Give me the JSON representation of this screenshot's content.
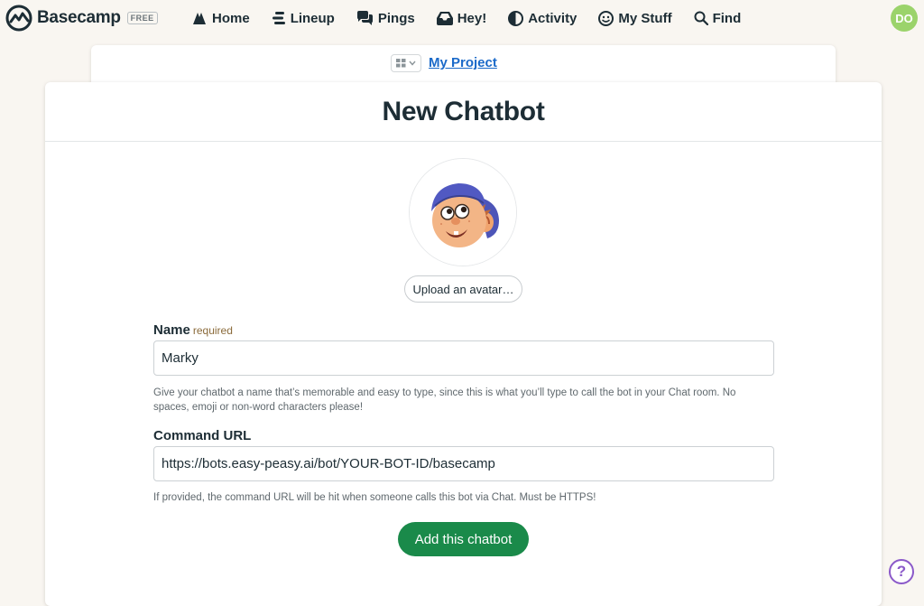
{
  "brand": {
    "name": "Basecamp",
    "plan_badge": "FREE"
  },
  "nav": {
    "items": [
      {
        "label": "Home",
        "icon": "home-icon"
      },
      {
        "label": "Lineup",
        "icon": "lineup-icon"
      },
      {
        "label": "Pings",
        "icon": "pings-icon"
      },
      {
        "label": "Hey!",
        "icon": "hey-icon"
      },
      {
        "label": "Activity",
        "icon": "activity-icon"
      },
      {
        "label": "My Stuff",
        "icon": "my-stuff-icon"
      },
      {
        "label": "Find",
        "icon": "search-icon"
      }
    ],
    "user_initials": "DO"
  },
  "project": {
    "name": "My Project"
  },
  "page": {
    "title": "New Chatbot"
  },
  "avatar": {
    "upload_label": "Upload an avatar…"
  },
  "form": {
    "name": {
      "label": "Name",
      "required_label": "required",
      "value": "Marky",
      "hint": "Give your chatbot a name that’s memorable and easy to type, since this is what you’ll type to call the bot in your Chat room. No spaces, emoji or non-word characters please!"
    },
    "command_url": {
      "label": "Command URL",
      "value": "https://bots.easy-peasy.ai/bot/YOUR-BOT-ID/basecamp",
      "hint": "If provided, the command URL will be hit when someone calls this bot via Chat. Must be HTTPS!"
    },
    "submit_label": "Add this chatbot"
  },
  "help": {
    "label": "?"
  },
  "colors": {
    "background": "#f9f6f1",
    "link": "#1b6ac9",
    "submit": "#1a8a4a",
    "user_avatar": "#9bd36b",
    "help": "#8b59c9"
  }
}
